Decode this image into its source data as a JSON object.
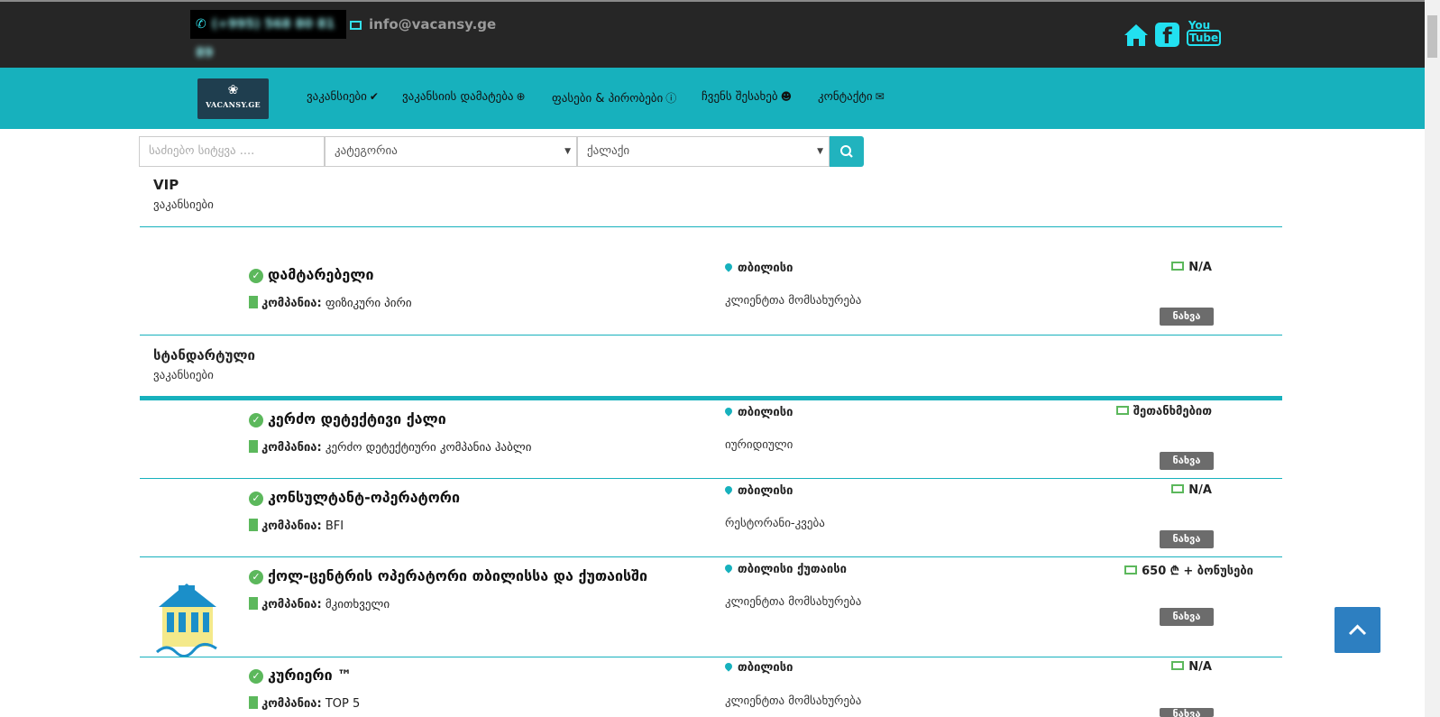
{
  "topbar": {
    "phone": "(+995) 568 80 81 89",
    "email": "info@vacansy.ge"
  },
  "brand": {
    "logo_text": "VACANSY.GE"
  },
  "nav": [
    {
      "label": "ვაკანსიები",
      "icon": "check-icon"
    },
    {
      "label": "ვაკანსიის დამატება",
      "icon": "plus-circle-icon"
    },
    {
      "label": "ფასები & პირობები",
      "icon": "info-circle-icon"
    },
    {
      "label": "ჩვენს შესახებ",
      "icon": "user-circle-icon"
    },
    {
      "label": "კონტაქტი",
      "icon": "envelope-icon"
    }
  ],
  "search": {
    "placeholder": "საძიებო სიტყვა ....",
    "category": "კატეგორია",
    "city": "ქალაქი"
  },
  "sections": {
    "vip_title": "VIP",
    "vip_sub": "ვაკანსიები",
    "std_title": "სტანდარტული",
    "std_sub": "ვაკანსიები"
  },
  "company_label": "კომპანია:",
  "view_label": "ნახვა",
  "jobs": [
    {
      "title": "დამტარებელი",
      "company": "ფიზიკური პირი",
      "city": "თბილისი",
      "category": "კლიენტთა მომსახურება",
      "salary": "N/A"
    },
    {
      "title": "კერძო დეტექტივი ქალი",
      "company": "კერძო დეტექტიური კომპანია ჰაბლი",
      "city": "თბილისი",
      "category": "იურიდიული",
      "salary": "შეთანხმებით"
    },
    {
      "title": "კონსულტანტ-ოპერატორი",
      "company": "BFI",
      "city": "თბილისი",
      "category": "რესტორანი-კვება",
      "salary": "N/A"
    },
    {
      "title": "ქოლ-ცენტრის ოპერატორი თბილისსა და ქუთაისში",
      "company": "მკითხველი",
      "city": "თბილისი ქუთაისი",
      "category": "კლიენტთა მომსახურება",
      "salary": "650 ₾ + ბონუსები"
    },
    {
      "title": "კურიერი ™",
      "company": "TOP 5",
      "city": "თბილისი",
      "category": "კლიენტთა მომსახურება",
      "salary": "N/A"
    }
  ],
  "colors": {
    "teal": "#17b1bd",
    "dark": "#262626",
    "green": "#5cb85c",
    "scroll_button": "#2d7fc1"
  }
}
